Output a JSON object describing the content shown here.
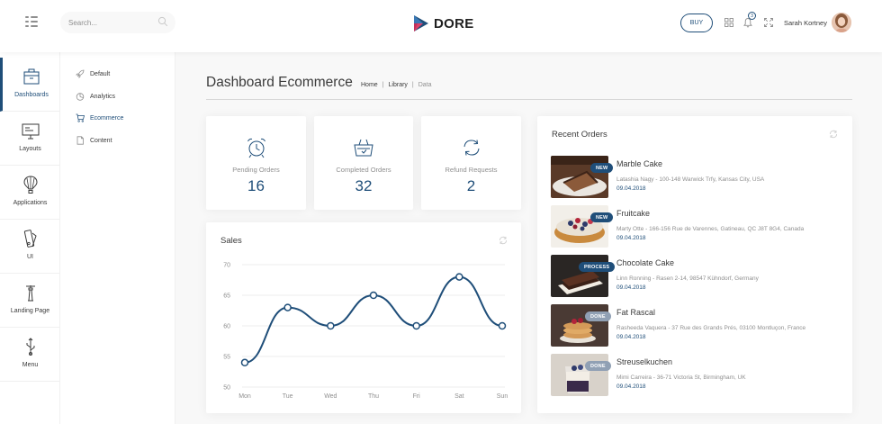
{
  "header": {
    "search_placeholder": "Search...",
    "brand": "DORE",
    "buy_label": "BUY",
    "notification_count": "3",
    "user_name": "Sarah Kortney"
  },
  "main_menu": [
    {
      "label": "Dashboards",
      "icon": "shop-icon",
      "active": true
    },
    {
      "label": "Layouts",
      "icon": "monitor-icon",
      "active": false
    },
    {
      "label": "Applications",
      "icon": "air-balloon-icon",
      "active": false
    },
    {
      "label": "UI",
      "icon": "pantone-icon",
      "active": false
    },
    {
      "label": "Landing Page",
      "icon": "lighthouse-icon",
      "active": false
    },
    {
      "label": "Menu",
      "icon": "usb-icon",
      "active": false
    }
  ],
  "sub_menu": [
    {
      "label": "Default",
      "icon": "rocket-icon",
      "active": false
    },
    {
      "label": "Analytics",
      "icon": "pie-chart-icon",
      "active": false
    },
    {
      "label": "Ecommerce",
      "icon": "cart-icon",
      "active": true
    },
    {
      "label": "Content",
      "icon": "file-icon",
      "active": false
    }
  ],
  "page": {
    "title": "Dashboard Ecommerce",
    "breadcrumb": [
      "Home",
      "Library",
      "Data"
    ]
  },
  "stats": [
    {
      "label": "Pending Orders",
      "value": "16",
      "icon": "alarm-clock-icon"
    },
    {
      "label": "Completed Orders",
      "value": "32",
      "icon": "basket-icon"
    },
    {
      "label": "Refund Requests",
      "value": "2",
      "icon": "refresh-arrows-icon"
    }
  ],
  "sales": {
    "title": "Sales"
  },
  "chart_data": {
    "type": "line",
    "title": "Sales",
    "categories": [
      "Mon",
      "Tue",
      "Wed",
      "Thu",
      "Fri",
      "Sat",
      "Sun"
    ],
    "values": [
      54,
      63,
      60,
      65,
      60,
      68,
      60
    ],
    "ylim": [
      50,
      70
    ],
    "yticks": [
      50,
      55,
      60,
      65,
      70
    ],
    "grid": true,
    "line_color": "#1f4e79"
  },
  "orders": {
    "title": "Recent Orders",
    "items": [
      {
        "name": "Marble Cake",
        "address": "Latashia Nagy - 100-148 Warwick Trfy, Kansas City, USA",
        "date": "09.04.2018",
        "status": "NEW"
      },
      {
        "name": "Fruitcake",
        "address": "Marty Otte - 166-156 Rue de Varennes, Gatineau, QC J8T 8G4, Canada",
        "date": "09.04.2018",
        "status": "NEW"
      },
      {
        "name": "Chocolate Cake",
        "address": "Linn Ronning - Rasen 2-14, 98547 Kühndorf, Germany",
        "date": "09.04.2018",
        "status": "PROCESS"
      },
      {
        "name": "Fat Rascal",
        "address": "Rasheeda Vaquera - 37 Rue des Grands Prés, 03100 Montluçon, France",
        "date": "09.04.2018",
        "status": "DONE"
      },
      {
        "name": "Streuselkuchen",
        "address": "Mimi Carreira - 36-71 Victoria St, Birmingham, UK",
        "date": "09.04.2018",
        "status": "DONE"
      }
    ]
  },
  "colors": {
    "primary": "#1f4e79",
    "muted": "#8f8f8f",
    "text": "#3a3a3a",
    "background": "#f8f8f8"
  }
}
